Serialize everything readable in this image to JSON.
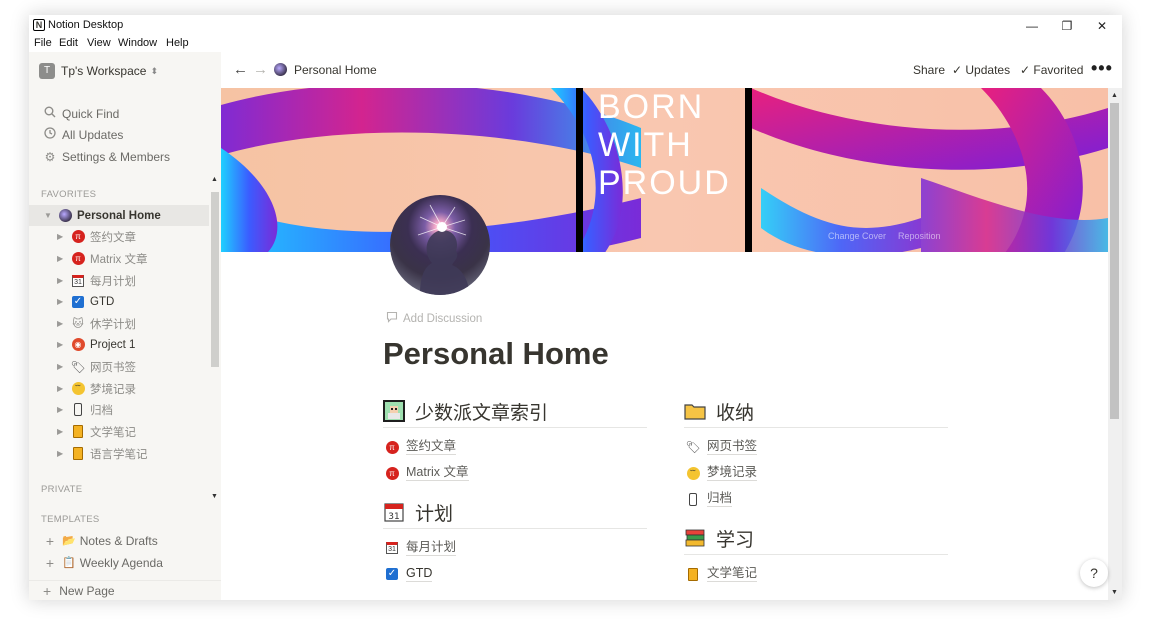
{
  "window": {
    "title": "Notion Desktop"
  },
  "menu": [
    "File",
    "Edit",
    "View",
    "Window",
    "Help"
  ],
  "sidebar": {
    "workspace_badge": "T",
    "workspace_name": "Tp's Workspace",
    "quick_find": "Quick Find",
    "all_updates": "All Updates",
    "settings": "Settings & Members",
    "favorites_label": "FAVORITES",
    "favorites": [
      {
        "label": "Personal Home",
        "icon": "avatar-icon"
      },
      {
        "label": "签约文章",
        "icon": "sspai-icon"
      },
      {
        "label": "Matrix 文章",
        "icon": "sspai-icon"
      },
      {
        "label": "每月计划",
        "icon": "calendar-icon"
      },
      {
        "label": "GTD",
        "icon": "checkbox-icon"
      },
      {
        "label": "休学计划",
        "icon": "cat-icon"
      },
      {
        "label": "Project 1",
        "icon": "project-icon"
      },
      {
        "label": "网页书签",
        "icon": "tag-icon"
      },
      {
        "label": "梦境记录",
        "icon": "sleepy-face-icon"
      },
      {
        "label": "归档",
        "icon": "phone-icon"
      },
      {
        "label": "文学笔记",
        "icon": "notebook-icon"
      },
      {
        "label": "语言学笔记",
        "icon": "notebook-icon"
      }
    ],
    "private_label": "PRIVATE",
    "templates_label": "TEMPLATES",
    "templates": [
      {
        "label": "Notes & Drafts",
        "icon": "folder-pen-icon"
      },
      {
        "label": "Weekly Agenda",
        "icon": "clipboard-icon"
      }
    ],
    "new_page": "New Page"
  },
  "topbar": {
    "breadcrumb": "Personal Home",
    "share": "Share",
    "updates": "Updates",
    "favorited": "Favorited"
  },
  "cover": {
    "text_lines": [
      "BORN",
      "WITH",
      "PROUD"
    ],
    "change_cover": "Change Cover",
    "reposition": "Reposition"
  },
  "page": {
    "add_discussion": "Add Discussion",
    "title": "Personal Home"
  },
  "columns": {
    "left": [
      {
        "heading": "少数派文章索引",
        "icon": "pixel-art-icon",
        "links": [
          {
            "label": "签约文章",
            "icon": "sspai-icon"
          },
          {
            "label": "Matrix 文章",
            "icon": "sspai-icon"
          }
        ]
      },
      {
        "heading": "计划",
        "icon": "calendar-icon",
        "links": [
          {
            "label": "每月计划",
            "icon": "calendar-icon"
          },
          {
            "label": "GTD",
            "icon": "checkbox-icon"
          }
        ]
      }
    ],
    "right": [
      {
        "heading": "收纳",
        "icon": "folder-icon",
        "links": [
          {
            "label": "网页书签",
            "icon": "tag-icon"
          },
          {
            "label": "梦境记录",
            "icon": "sleepy-face-icon"
          },
          {
            "label": "归档",
            "icon": "phone-icon"
          }
        ]
      },
      {
        "heading": "学习",
        "icon": "books-icon",
        "links": [
          {
            "label": "文学笔记",
            "icon": "notebook-icon"
          }
        ]
      }
    ]
  },
  "help": "?",
  "colors": {
    "sidebar_bg": "#f7f6f3",
    "text": "#37352f",
    "accent_red": "#d6231e",
    "check_blue": "#1f6fd1"
  }
}
